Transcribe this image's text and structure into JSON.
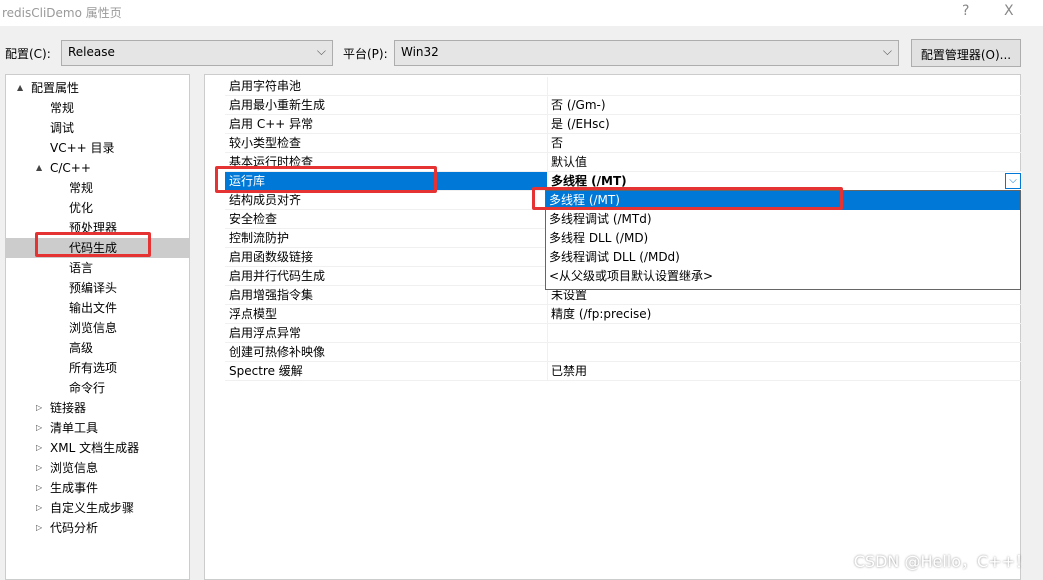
{
  "window": {
    "title": "redisCliDemo 属性页",
    "help": "?",
    "close": "X"
  },
  "toolbar": {
    "config_label": "配置(C):",
    "config_value": "Release",
    "platform_label": "平台(P):",
    "platform_value": "Win32",
    "config_manager": "配置管理器(O)..."
  },
  "tree": [
    {
      "label": "配置属性",
      "level": 0,
      "toggle": "▲"
    },
    {
      "label": "常规",
      "level": 1
    },
    {
      "label": "调试",
      "level": 1
    },
    {
      "label": "VC++ 目录",
      "level": 1
    },
    {
      "label": "C/C++",
      "level": 1,
      "toggle": "▲"
    },
    {
      "label": "常规",
      "level": 2
    },
    {
      "label": "优化",
      "level": 2
    },
    {
      "label": "预处理器",
      "level": 2
    },
    {
      "label": "代码生成",
      "level": 2,
      "selected": true
    },
    {
      "label": "语言",
      "level": 2
    },
    {
      "label": "预编译头",
      "level": 2
    },
    {
      "label": "输出文件",
      "level": 2
    },
    {
      "label": "浏览信息",
      "level": 2
    },
    {
      "label": "高级",
      "level": 2
    },
    {
      "label": "所有选项",
      "level": 2
    },
    {
      "label": "命令行",
      "level": 2
    },
    {
      "label": "链接器",
      "level": 1,
      "toggle": "▷"
    },
    {
      "label": "清单工具",
      "level": 1,
      "toggle": "▷"
    },
    {
      "label": "XML 文档生成器",
      "level": 1,
      "toggle": "▷"
    },
    {
      "label": "浏览信息",
      "level": 1,
      "toggle": "▷"
    },
    {
      "label": "生成事件",
      "level": 1,
      "toggle": "▷"
    },
    {
      "label": "自定义生成步骤",
      "level": 1,
      "toggle": "▷"
    },
    {
      "label": "代码分析",
      "level": 1,
      "toggle": "▷"
    }
  ],
  "properties": [
    {
      "name": "启用字符串池",
      "value": ""
    },
    {
      "name": "启用最小重新生成",
      "value": "否 (/Gm-)"
    },
    {
      "name": "启用 C++ 异常",
      "value": "是 (/EHsc)"
    },
    {
      "name": "较小类型检查",
      "value": "否"
    },
    {
      "name": "基本运行时检查",
      "value": "默认值"
    },
    {
      "name": "运行库",
      "value": "多线程 (/MT)",
      "selected": true
    },
    {
      "name": "结构成员对齐",
      "value": ""
    },
    {
      "name": "安全检查",
      "value": ""
    },
    {
      "name": "控制流防护",
      "value": ""
    },
    {
      "name": "启用函数级链接",
      "value": ""
    },
    {
      "name": "启用并行代码生成",
      "value": ""
    },
    {
      "name": "启用增强指令集",
      "value": "未设置"
    },
    {
      "name": "浮点模型",
      "value": "精度 (/fp:precise)"
    },
    {
      "name": "启用浮点异常",
      "value": ""
    },
    {
      "name": "创建可热修补映像",
      "value": ""
    },
    {
      "name": "Spectre 缓解",
      "value": "已禁用"
    }
  ],
  "dropdown": {
    "options": [
      "多线程 (/MT)",
      "多线程调试 (/MTd)",
      "多线程 DLL (/MD)",
      "多线程调试 DLL (/MDd)",
      "<从父级或项目默认设置继承>"
    ],
    "selected_index": 0
  },
  "watermark": "CSDN @Hello，C++！",
  "colors": {
    "selection": "#0078d7",
    "highlight_box": "#e53333"
  }
}
